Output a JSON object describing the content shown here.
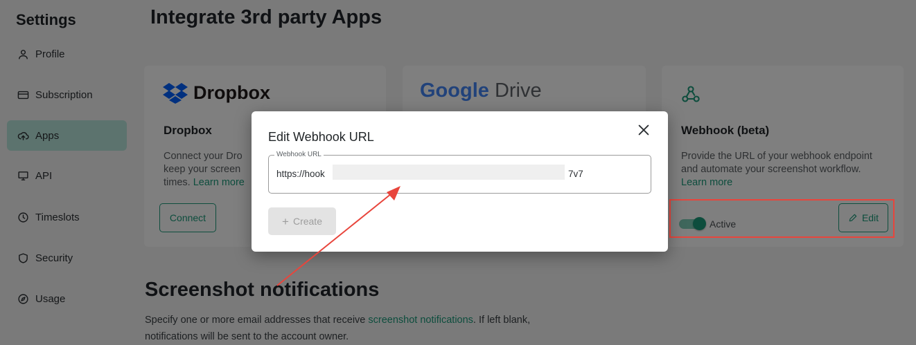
{
  "sidebar": {
    "title": "Settings",
    "items": [
      {
        "label": "Profile",
        "icon": "user-icon"
      },
      {
        "label": "Subscription",
        "icon": "credit-card-icon"
      },
      {
        "label": "Apps",
        "icon": "cloud-upload-icon",
        "active": true
      },
      {
        "label": "API",
        "icon": "monitor-icon"
      },
      {
        "label": "Timeslots",
        "icon": "clock-icon"
      },
      {
        "label": "Security",
        "icon": "shield-icon"
      },
      {
        "label": "Usage",
        "icon": "compass-icon"
      }
    ]
  },
  "main": {
    "title": "Integrate 3rd party Apps",
    "cards": {
      "dropbox": {
        "logo_text": "Dropbox",
        "name": "Dropbox",
        "desc": "Connect your Dro",
        "desc2": "keep your screen",
        "desc3": "times.",
        "link": "Learn more",
        "button": "Connect"
      },
      "drive": {
        "logo_google": "Google",
        "logo_drive": "Drive"
      },
      "webhook": {
        "name": "Webhook (beta)",
        "desc": "Provide the URL of your webhook endpoint and automate your screenshot workflow.",
        "link": "Learn more",
        "toggle_label": "Active",
        "toggle_on": true,
        "button": "Edit"
      }
    },
    "notifications": {
      "title": "Screenshot notifications",
      "desc_pre": "Specify one or more email addresses that receive ",
      "desc_link": "screenshot notifications",
      "desc_post": ". If left blank, notifications will be sent to the account owner."
    }
  },
  "modal": {
    "title": "Edit Webhook URL",
    "field_label": "Webhook URL",
    "field_value_start": "https://hook",
    "field_value_end": "7v7",
    "create_button": "Create"
  },
  "colors": {
    "accent": "#1a9a7a",
    "annotation": "#e8453c",
    "active_nav": "#b9e6dc"
  }
}
